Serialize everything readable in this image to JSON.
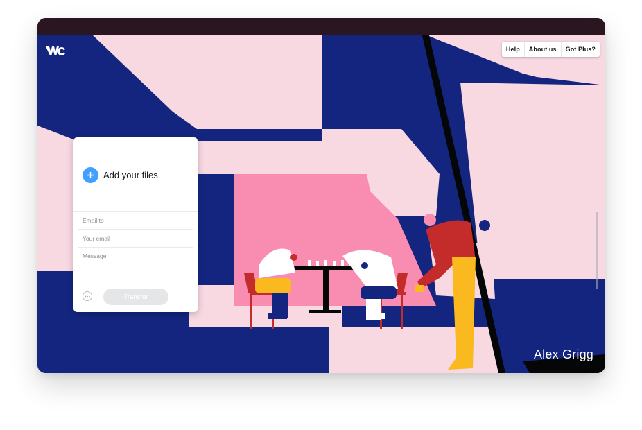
{
  "nav": {
    "help": "Help",
    "about": "About us",
    "plus": "Got Plus?"
  },
  "panel": {
    "add_files_label": "Add your files",
    "email_to_placeholder": "Email to",
    "your_email_placeholder": "Your email",
    "message_placeholder": "Message",
    "transfer_label": "Transfer"
  },
  "artwork": {
    "credit": "Alex Grigg"
  },
  "icons": {
    "logo": "wetransfer-logo",
    "add": "plus-icon",
    "more": "more-options-icon"
  },
  "colors": {
    "navy": "#13257f",
    "pink_light": "#f8d8e1",
    "pink": "#f98cb1",
    "accent_blue": "#409fff",
    "red": "#c42b2b",
    "yellow": "#f9b91f",
    "transfer_disabled": "#e5e6e8"
  }
}
